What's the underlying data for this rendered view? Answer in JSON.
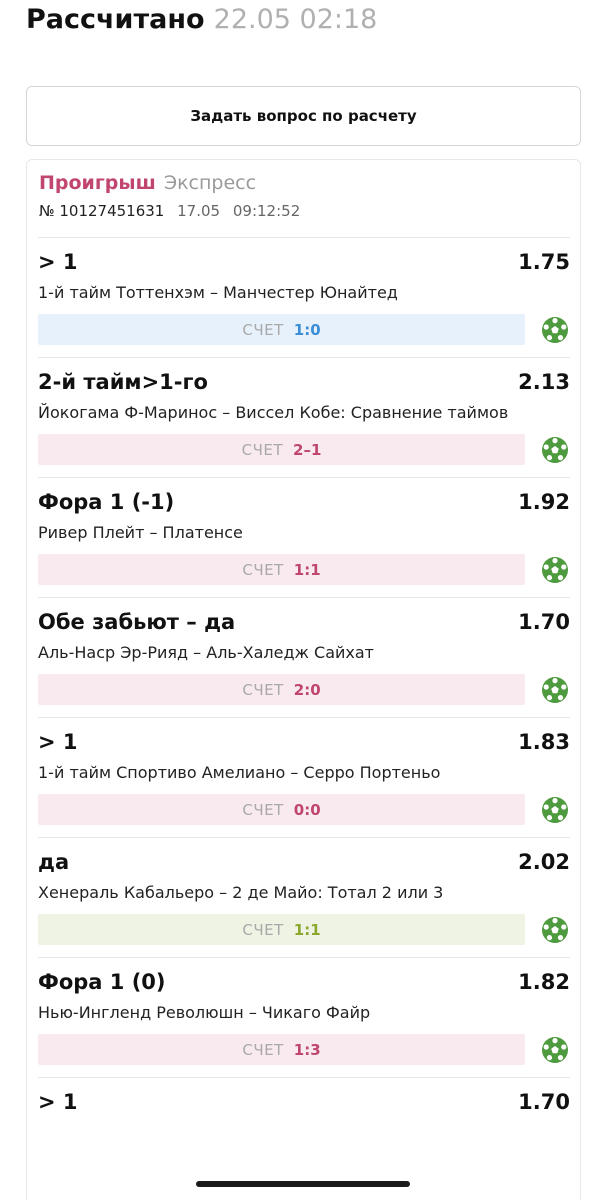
{
  "header": {
    "title": "Рассчитано",
    "timestamp": "22.05 02:18"
  },
  "ask_button": {
    "label": "Задать вопрос по расчету"
  },
  "ticket": {
    "result": "Проигрыш",
    "type": "Экспресс",
    "number": "№ 10127451631",
    "date": "17.05",
    "time": "09:12:52"
  },
  "bets": [
    {
      "name": "> 1",
      "odds": "1.75",
      "desc": "1-й тайм Тоттенхэм – Манчестер Юнайтед",
      "score_label": "СЧЕТ",
      "score": "1:0",
      "status": "win",
      "icon": "soccer-ball-icon"
    },
    {
      "name": "2-й тайм>1-го",
      "odds": "2.13",
      "desc": "Йокогама Ф-Маринос – Виссел Кобе: Сравнение таймов",
      "score_label": "СЧЕТ",
      "score": "2–1",
      "status": "lose",
      "icon": "soccer-ball-icon"
    },
    {
      "name": "Фора 1 (-1)",
      "odds": "1.92",
      "desc": "Ривер Плейт – Платенсе",
      "score_label": "СЧЕТ",
      "score": "1:1",
      "status": "lose",
      "icon": "soccer-ball-icon"
    },
    {
      "name": "Обе забьют – да",
      "odds": "1.70",
      "desc": "Аль-Наср Эр-Рияд – Аль-Халедж Сайхат",
      "score_label": "СЧЕТ",
      "score": "2:0",
      "status": "lose",
      "icon": "soccer-ball-icon"
    },
    {
      "name": "> 1",
      "odds": "1.83",
      "desc": "1-й тайм Спортиво Амелиано – Серро Портеньо",
      "score_label": "СЧЕТ",
      "score": "0:0",
      "status": "lose",
      "icon": "soccer-ball-icon"
    },
    {
      "name": "да",
      "odds": "2.02",
      "desc": "Хенераль Кабальеро – 2 де Майо: Тотал 2 или 3",
      "score_label": "СЧЕТ",
      "score": "1:1",
      "status": "return",
      "icon": "soccer-ball-icon"
    },
    {
      "name": "Фора 1 (0)",
      "odds": "1.82",
      "desc": "Нью-Ингленд Революшн – Чикаго Файр",
      "score_label": "СЧЕТ",
      "score": "1:3",
      "status": "lose",
      "icon": "soccer-ball-icon"
    },
    {
      "name": "> 1",
      "odds": "1.70",
      "desc": "",
      "score_label": "",
      "score": "",
      "status": "",
      "icon": ""
    }
  ],
  "colors": {
    "lose": "#c0466f",
    "win": "#3a8dd6",
    "return": "#8aa82c",
    "ball": "#4e9a3e"
  }
}
